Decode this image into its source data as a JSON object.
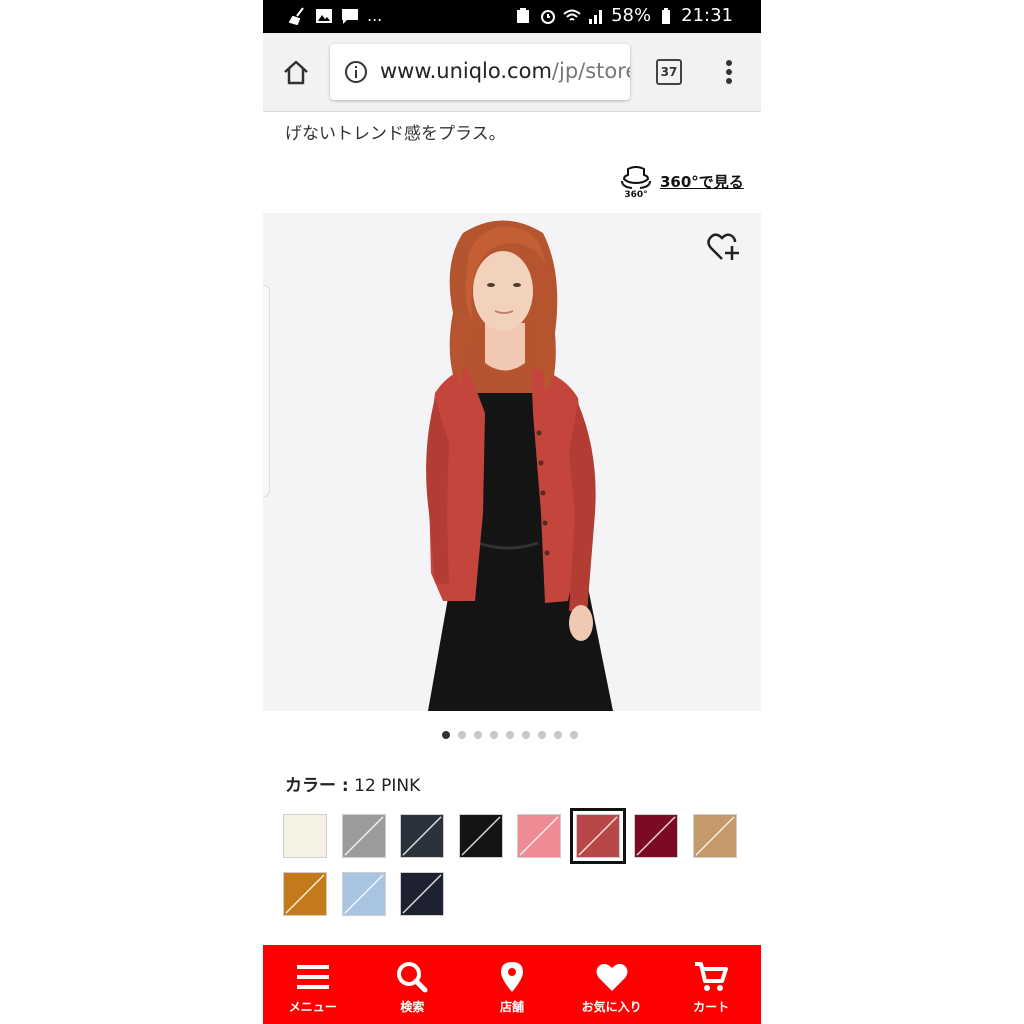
{
  "status_bar": {
    "left_more": "...",
    "battery": "58%",
    "time": "21:31"
  },
  "address_bar": {
    "url_domain": "www.uniqlo.com",
    "url_rest": "/jp/store",
    "tab_count": "37"
  },
  "product": {
    "description_line": "げないトレンド感をプラス。",
    "view360_icon_text": "360°",
    "view360_label": "360°で見る",
    "gallery_count": 9,
    "gallery_active_index": 0,
    "color_label": "カラー :",
    "color_value": "12 PINK",
    "swatches": [
      {
        "color": "#f6f2e3",
        "selected": false
      },
      {
        "color": "#9b9b9b",
        "selected": false
      },
      {
        "color": "#2b323b",
        "selected": false
      },
      {
        "color": "#141414",
        "selected": false
      },
      {
        "color": "#ee8a93",
        "selected": false
      },
      {
        "color": "#b84848",
        "selected": true
      },
      {
        "color": "#7b0a22",
        "selected": false
      },
      {
        "color": "#c49a6c",
        "selected": false
      },
      {
        "color": "#c47a1a",
        "selected": false
      },
      {
        "color": "#a9c4e0",
        "selected": false
      },
      {
        "color": "#1e2130",
        "selected": false
      }
    ]
  },
  "bottom_nav": {
    "items": [
      {
        "label": "メニュー",
        "icon": "menu-icon"
      },
      {
        "label": "検索",
        "icon": "search-icon"
      },
      {
        "label": "店舗",
        "icon": "location-pin-icon"
      },
      {
        "label": "お気に入り",
        "icon": "heart-icon"
      },
      {
        "label": "カート",
        "icon": "cart-icon"
      }
    ]
  },
  "colors": {
    "nav_background": "#ff0000",
    "image_background": "#f4f3f5",
    "cardigan": "#c4453b"
  }
}
